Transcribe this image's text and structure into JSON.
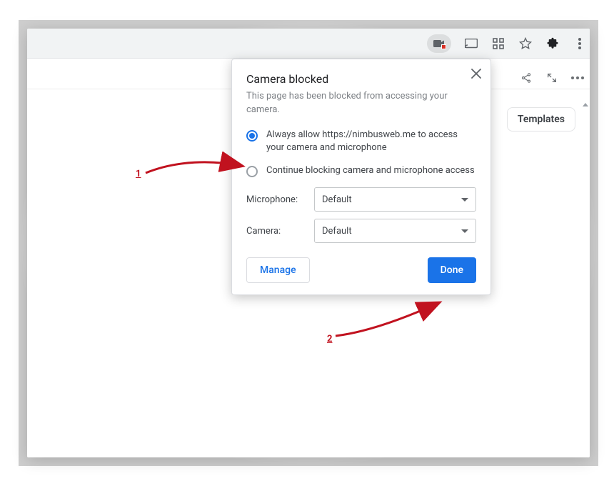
{
  "popup": {
    "title": "Camera blocked",
    "subtitle": "This page has been blocked from accessing your camera.",
    "option_allow": "Always allow https://nimbusweb.me to access your camera and microphone",
    "option_block": "Continue blocking camera and microphone access",
    "mic_label": "Microphone:",
    "cam_label": "Camera:",
    "mic_value": "Default",
    "cam_value": "Default",
    "manage_label": "Manage",
    "done_label": "Done"
  },
  "page": {
    "templates_label": "Templates"
  },
  "annotations": {
    "label1": "1",
    "label2": "2"
  }
}
